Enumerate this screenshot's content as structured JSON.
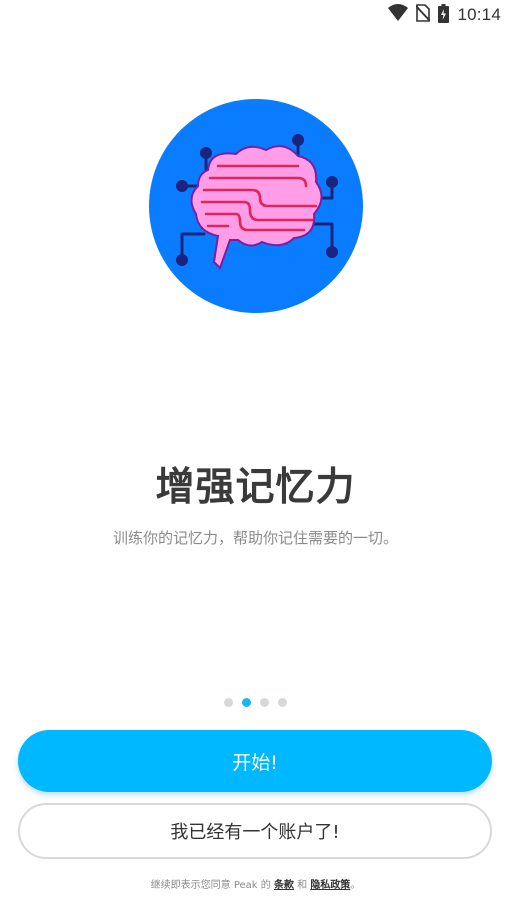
{
  "status_bar": {
    "time": "10:14",
    "icons": [
      "wifi-icon",
      "no-sim-icon",
      "battery-charging-icon"
    ]
  },
  "hero": {
    "icon": "brain-circuit-icon",
    "colors": {
      "circle": "#0a7cff",
      "brain": "#ff9ee6",
      "lines": "#e0245e",
      "nodes": "#1a237e"
    }
  },
  "onboarding": {
    "title": "增强记忆力",
    "subtitle": "训练你的记忆力，帮助你记住需要的一切。",
    "pager": {
      "total": 4,
      "active_index": 1
    }
  },
  "actions": {
    "start_label": "开始!",
    "login_label": "我已经有一个账户了!"
  },
  "legal": {
    "prefix": "继续即表示您同意 Peak 的 ",
    "terms": "条款",
    "conjunction": " 和 ",
    "privacy": "隐私政策",
    "suffix": "。"
  },
  "colors": {
    "primary": "#00b8ff",
    "title": "#3a3a3a",
    "muted": "#8a8a8a",
    "dot_active": "#1ab6f2",
    "dot_inactive": "#d5d8dc"
  }
}
